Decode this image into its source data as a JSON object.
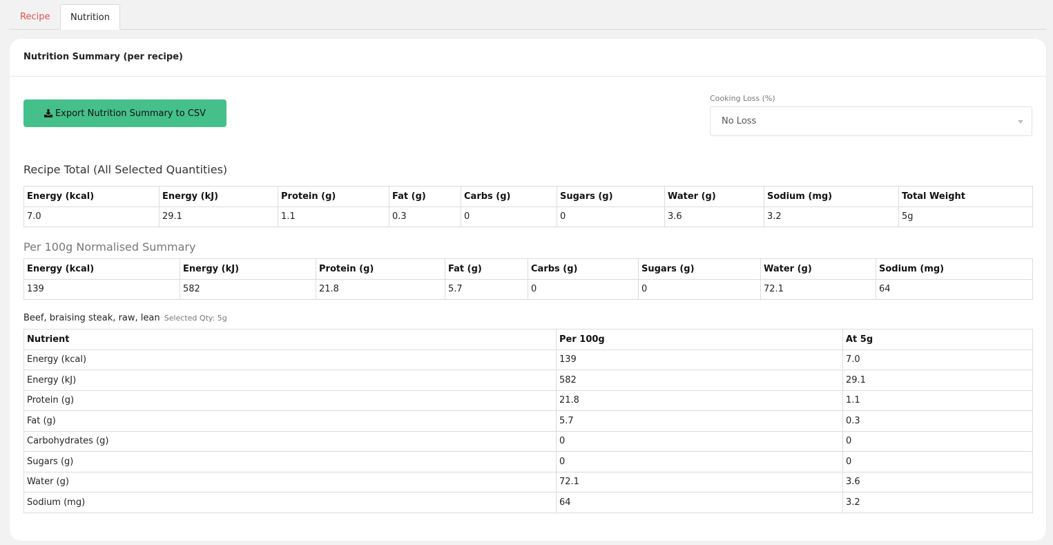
{
  "tabs": [
    {
      "label": "Recipe",
      "active": false
    },
    {
      "label": "Nutrition",
      "active": true
    }
  ],
  "card": {
    "title": "Nutrition Summary (per recipe)",
    "export_label": "Export Nutrition Summary to CSV",
    "export_icon": "download-icon",
    "cooking_loss": {
      "label": "Cooking Loss (%)",
      "value": "No Loss"
    }
  },
  "colors": {
    "accent_button": "#45c08a",
    "active_tab_link": "#d9534f"
  },
  "recipe_total": {
    "title": "Recipe Total (All Selected Quantities)",
    "headers": [
      "Energy (kcal)",
      "Energy (kJ)",
      "Protein (g)",
      "Fat (g)",
      "Carbs (g)",
      "Sugars (g)",
      "Water (g)",
      "Sodium (mg)",
      "Total Weight"
    ],
    "values": [
      "7.0",
      "29.1",
      "1.1",
      "0.3",
      "0",
      "0",
      "3.6",
      "3.2",
      "5g"
    ]
  },
  "per100": {
    "title": "Per 100g Normalised Summary",
    "headers": [
      "Energy (kcal)",
      "Energy (kJ)",
      "Protein (g)",
      "Fat (g)",
      "Carbs (g)",
      "Sugars (g)",
      "Water (g)",
      "Sodium (mg)"
    ],
    "values": [
      "139",
      "582",
      "21.8",
      "5.7",
      "0",
      "0",
      "72.1",
      "64"
    ]
  },
  "food": {
    "name": "Beef, braising steak, raw, lean",
    "qty_label": "Selected Qty: 5g",
    "headers": [
      "Nutrient",
      "Per 100g",
      "At 5g"
    ],
    "rows": [
      [
        "Energy (kcal)",
        "139",
        "7.0"
      ],
      [
        "Energy (kJ)",
        "582",
        "29.1"
      ],
      [
        "Protein (g)",
        "21.8",
        "1.1"
      ],
      [
        "Fat (g)",
        "5.7",
        "0.3"
      ],
      [
        "Carbohydrates (g)",
        "0",
        "0"
      ],
      [
        "Sugars (g)",
        "0",
        "0"
      ],
      [
        "Water (g)",
        "72.1",
        "3.6"
      ],
      [
        "Sodium (mg)",
        "64",
        "3.2"
      ]
    ]
  }
}
